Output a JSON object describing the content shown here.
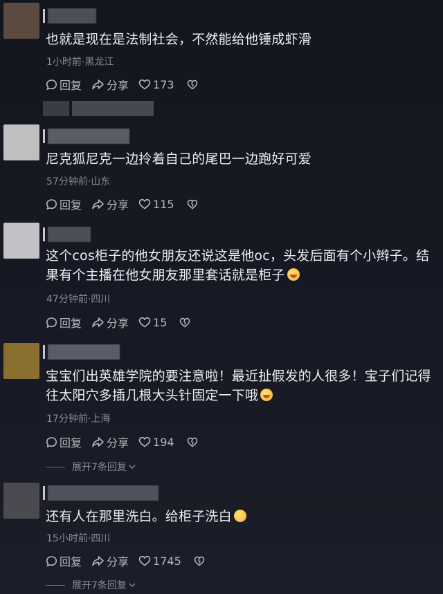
{
  "comments": [
    {
      "text": "也就是现在是法制社会，不然能给他锤成虾滑",
      "meta": "1小时前·黑龙江",
      "reply_label": "回复",
      "share_label": "分享",
      "likes": "173",
      "avatar_color": "#5a4a3f"
    },
    {
      "text": "尼克狐尼克一边拎着自己的尾巴一边跑好可爱",
      "meta": "57分钟前·山东",
      "reply_label": "回复",
      "share_label": "分享",
      "likes": "115",
      "avatar_color": "#bfbfc2"
    },
    {
      "text": "这个cos柜子的他女朋友还说这是他oc，头发后面有个小辫子。结果有个主播在他女朋友那里套话就是柜子",
      "meta": "47分钟前·四川",
      "reply_label": "回复",
      "share_label": "分享",
      "likes": "15",
      "avatar_color": "#c2c2c6"
    },
    {
      "text": "宝宝们出英雄学院的要注意啦！最近扯假发的人很多！宝子们记得往太阳穴多插几根大头针固定一下哦",
      "meta": "17分钟前·上海",
      "reply_label": "回复",
      "share_label": "分享",
      "likes": "194",
      "expand_label": "展开7条回复",
      "avatar_color": "#8a6f2e"
    },
    {
      "text": "还有人在那里洗白。给柜子洗白",
      "meta": "15小时前·四川",
      "reply_label": "回复",
      "share_label": "分享",
      "likes": "1745",
      "expand_label": "展开7条回复",
      "avatar_color": "#4a4a50"
    }
  ],
  "colors": {
    "background": "#161823",
    "text": "#ececf0",
    "meta": "#8a8b93",
    "action": "#b7b8be"
  }
}
